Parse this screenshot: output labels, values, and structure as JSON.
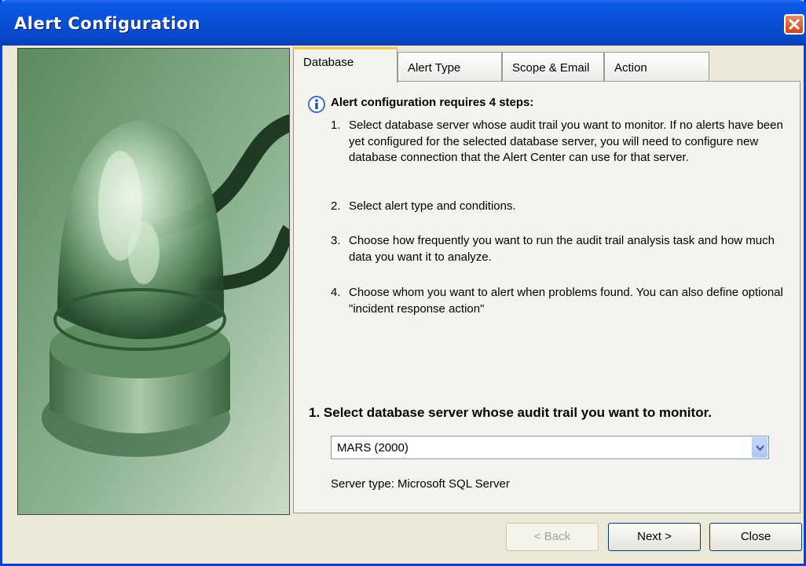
{
  "window": {
    "title": "Alert Configuration"
  },
  "tabs": [
    {
      "label": "Database",
      "active": true
    },
    {
      "label": "Alert Type",
      "active": false
    },
    {
      "label": "Scope & Email",
      "active": false
    },
    {
      "label": "Action",
      "active": false
    }
  ],
  "info": {
    "heading": "Alert configuration requires 4 steps:",
    "steps": [
      {
        "num": "1.",
        "text": "Select database server whose audit trail you want to monitor. If no alerts have been yet configured for the selected database server, you will need to configure new database connection that the Alert Center can use for that server."
      },
      {
        "num": "2.",
        "text": "Select alert type and conditions."
      },
      {
        "num": "3.",
        "text": "Choose how frequently you want to run the audit trail analysis task and how much data you want it to analyze."
      },
      {
        "num": "4.",
        "text": "Choose whom you want to alert when problems found. You can also define optional \"incident response action\""
      }
    ]
  },
  "select_section": {
    "label": "1. Select database server whose audit trail you want to monitor.",
    "selected_value": "MARS (2000)",
    "server_type": "Server type:  Microsoft SQL Server"
  },
  "buttons": {
    "back": "< Back",
    "next": "Next >",
    "close": "Close"
  },
  "colors": {
    "title_bar": "#0a51d8",
    "dialog_bg": "#ece9d8",
    "tab_highlight": "#ffc83c",
    "close_red": "#c9451f"
  },
  "icons": {
    "close": "close-icon",
    "info": "info-icon",
    "dropdown": "chevron-down-icon",
    "image": "alarm-beacon-image"
  }
}
